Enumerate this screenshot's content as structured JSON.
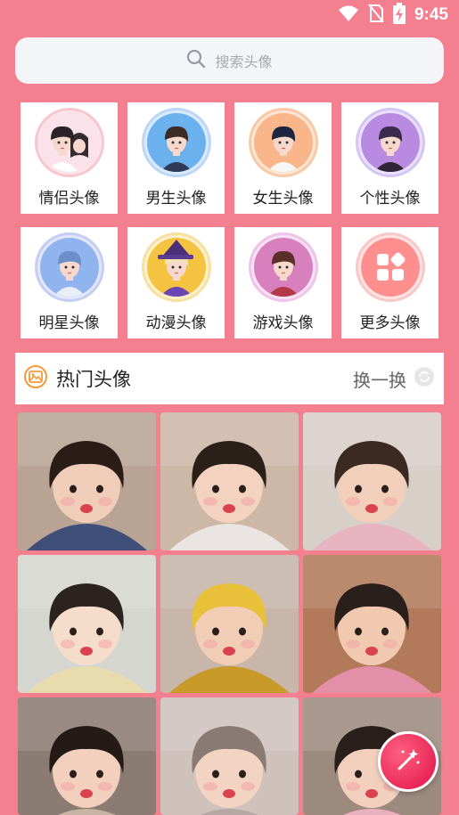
{
  "status_bar": {
    "time": "9:45",
    "icons": [
      "wifi-icon",
      "no-sim-icon",
      "battery-charging-icon"
    ]
  },
  "search": {
    "placeholder": "搜索头像",
    "icon": "search-icon"
  },
  "categories": [
    {
      "label": "情侣头像",
      "ring": "#f7c6cf",
      "bg": "#fde3e8"
    },
    {
      "label": "男生头像",
      "ring": "#bcd7f5",
      "bg": "#dbeafb"
    },
    {
      "label": "女生头像",
      "ring": "#f8c9a7",
      "bg": "#fde5d4"
    },
    {
      "label": "个性头像",
      "ring": "#d4c5f3",
      "bg": "#e9e0fb"
    },
    {
      "label": "明星头像",
      "ring": "#c5cdf4",
      "bg": "#e1e6fb"
    },
    {
      "label": "动漫头像",
      "ring": "#f8e0a0",
      "bg": "#fdf0cc"
    },
    {
      "label": "游戏头像",
      "ring": "#eec4ea",
      "bg": "#f8e1f5"
    },
    {
      "label": "更多头像",
      "ring": "#f9c8c8",
      "bg": "#fde2e2"
    }
  ],
  "hot": {
    "title": "热门头像",
    "refresh_label": "换一换",
    "icon": "photo-icon"
  },
  "photos": [
    {
      "name": "photo-1",
      "bg": "#b8a394",
      "skin": "#f0cdb8",
      "hair": "#2a1d18",
      "shirt": "#3f4f7a"
    },
    {
      "name": "photo-2",
      "bg": "#cdb8a8",
      "skin": "#f3d2bf",
      "hair": "#2b1f1a",
      "shirt": "#eae5e2"
    },
    {
      "name": "photo-3",
      "bg": "#d9cfc9",
      "skin": "#f1cfba",
      "hair": "#3a2a22",
      "shirt": "#e8b4c2"
    },
    {
      "name": "photo-4",
      "bg": "#d4d6cf",
      "skin": "#f6dccb",
      "hair": "#2c221f",
      "shirt": "#e8dcae"
    },
    {
      "name": "photo-5",
      "bg": "#c7b6a9",
      "skin": "#f1cdb6",
      "hair": "#e9c03a",
      "shirt": "#c89a2a"
    },
    {
      "name": "photo-6",
      "bg": "#b27a5a",
      "skin": "#f0c9b0",
      "hair": "#2a1f1a",
      "shirt": "#e48fa8"
    },
    {
      "name": "photo-7",
      "bg": "#8b7c73",
      "skin": "#f2d0bd",
      "hair": "#241a16",
      "shirt": "#c9b3a3"
    },
    {
      "name": "photo-8",
      "bg": "#cfc2bd",
      "skin": "#f3d3c1",
      "hair": "#8a7a74",
      "shirt": "#b5a8a4"
    },
    {
      "name": "photo-9",
      "bg": "#9c8a7e",
      "skin": "#f2d0bd",
      "hair": "#2a1f1a",
      "shirt": "#e9b1c0"
    }
  ],
  "fab": {
    "icon": "magic-wand-icon"
  }
}
